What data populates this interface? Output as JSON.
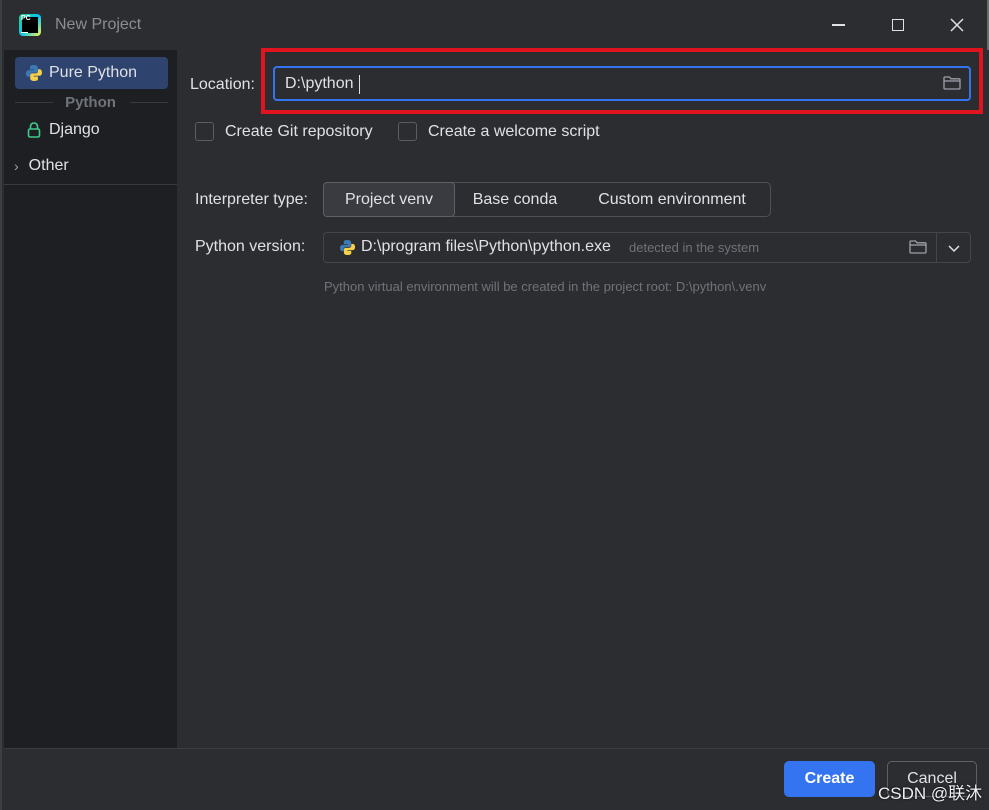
{
  "window": {
    "title": "New Project",
    "logo_text": "PC"
  },
  "sidebar": {
    "items": [
      {
        "label": "Pure Python",
        "icon": "python-icon",
        "selected": true
      },
      {
        "label": "Django",
        "icon": "django-lock-icon",
        "selected": false
      }
    ],
    "group_label": "Python",
    "other_label": "Other"
  },
  "form": {
    "location_label": "Location:",
    "location_value": "D:\\python",
    "create_git_label": "Create Git repository",
    "create_git_checked": false,
    "welcome_script_label": "Create a welcome script",
    "welcome_script_checked": false,
    "interpreter_type_label": "Interpreter type:",
    "interpreter_options": [
      "Project venv",
      "Base conda",
      "Custom environment"
    ],
    "interpreter_selected": "Project venv",
    "python_version_label": "Python version:",
    "python_path": "D:\\program files\\Python\\python.exe",
    "python_detected": "detected in the system",
    "venv_hint": "Python virtual environment will be created in the project root: D:\\python\\.venv"
  },
  "buttons": {
    "create": "Create",
    "cancel": "Cancel"
  },
  "watermark": "CSDN @联沐",
  "colors": {
    "accent": "#3574f0",
    "highlight": "#e0141f",
    "sidebar_selected": "#2e436e"
  }
}
